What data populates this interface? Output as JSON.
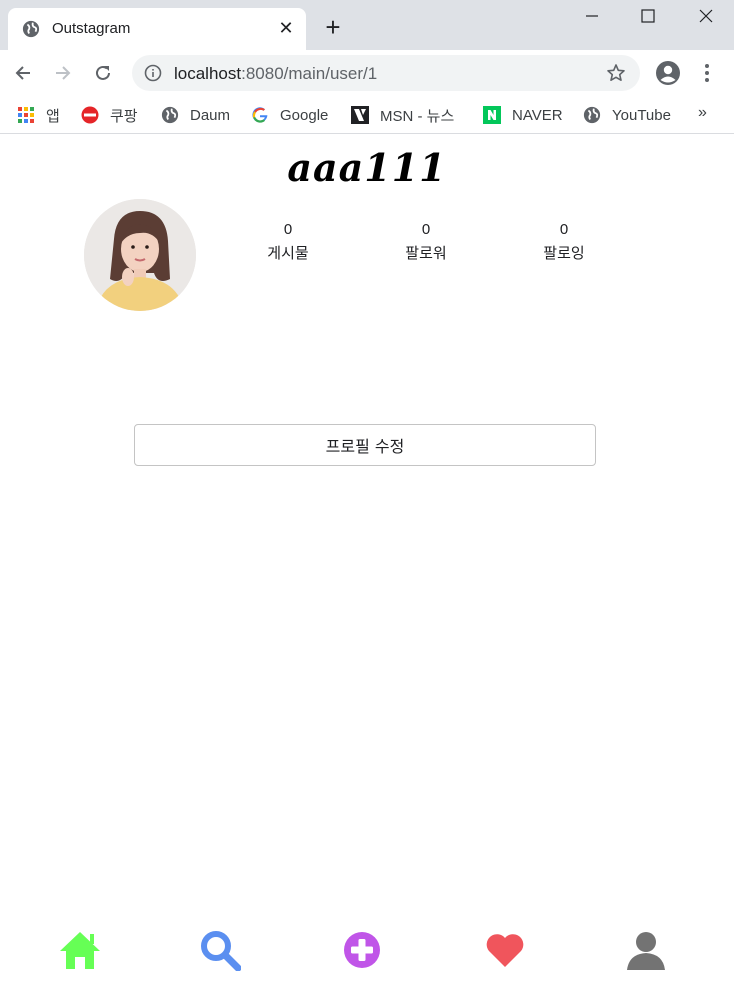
{
  "browser": {
    "tab_title": "Outstagram",
    "url_host": "localhost",
    "url_path": ":8080/main/user/1",
    "bookmarks": [
      {
        "label": "앱",
        "icon": "apps-grid-icon"
      },
      {
        "label": "쿠팡",
        "icon": "coupang-icon"
      },
      {
        "label": "Daum",
        "icon": "globe-icon"
      },
      {
        "label": "Google",
        "icon": "google-icon"
      },
      {
        "label": "MSN - 뉴스",
        "icon": "msn-icon"
      },
      {
        "label": "NAVER",
        "icon": "naver-icon"
      },
      {
        "label": "YouTube",
        "icon": "globe-icon"
      }
    ],
    "more_label": "»"
  },
  "profile": {
    "username": "aaa111",
    "stats": [
      {
        "value": "0",
        "label": "게시물"
      },
      {
        "value": "0",
        "label": "팔로워"
      },
      {
        "value": "0",
        "label": "팔로잉"
      }
    ],
    "edit_button": "프로필 수정"
  },
  "bottom_nav": [
    {
      "name": "home",
      "icon": "home-icon",
      "color": "#66ff55"
    },
    {
      "name": "search",
      "icon": "search-icon",
      "color": "#5b8ff0"
    },
    {
      "name": "add",
      "icon": "plus-circle-icon",
      "color": "#c055e8"
    },
    {
      "name": "activity",
      "icon": "heart-icon",
      "color": "#f0555c"
    },
    {
      "name": "profile",
      "icon": "user-icon",
      "color": "#737373"
    }
  ]
}
